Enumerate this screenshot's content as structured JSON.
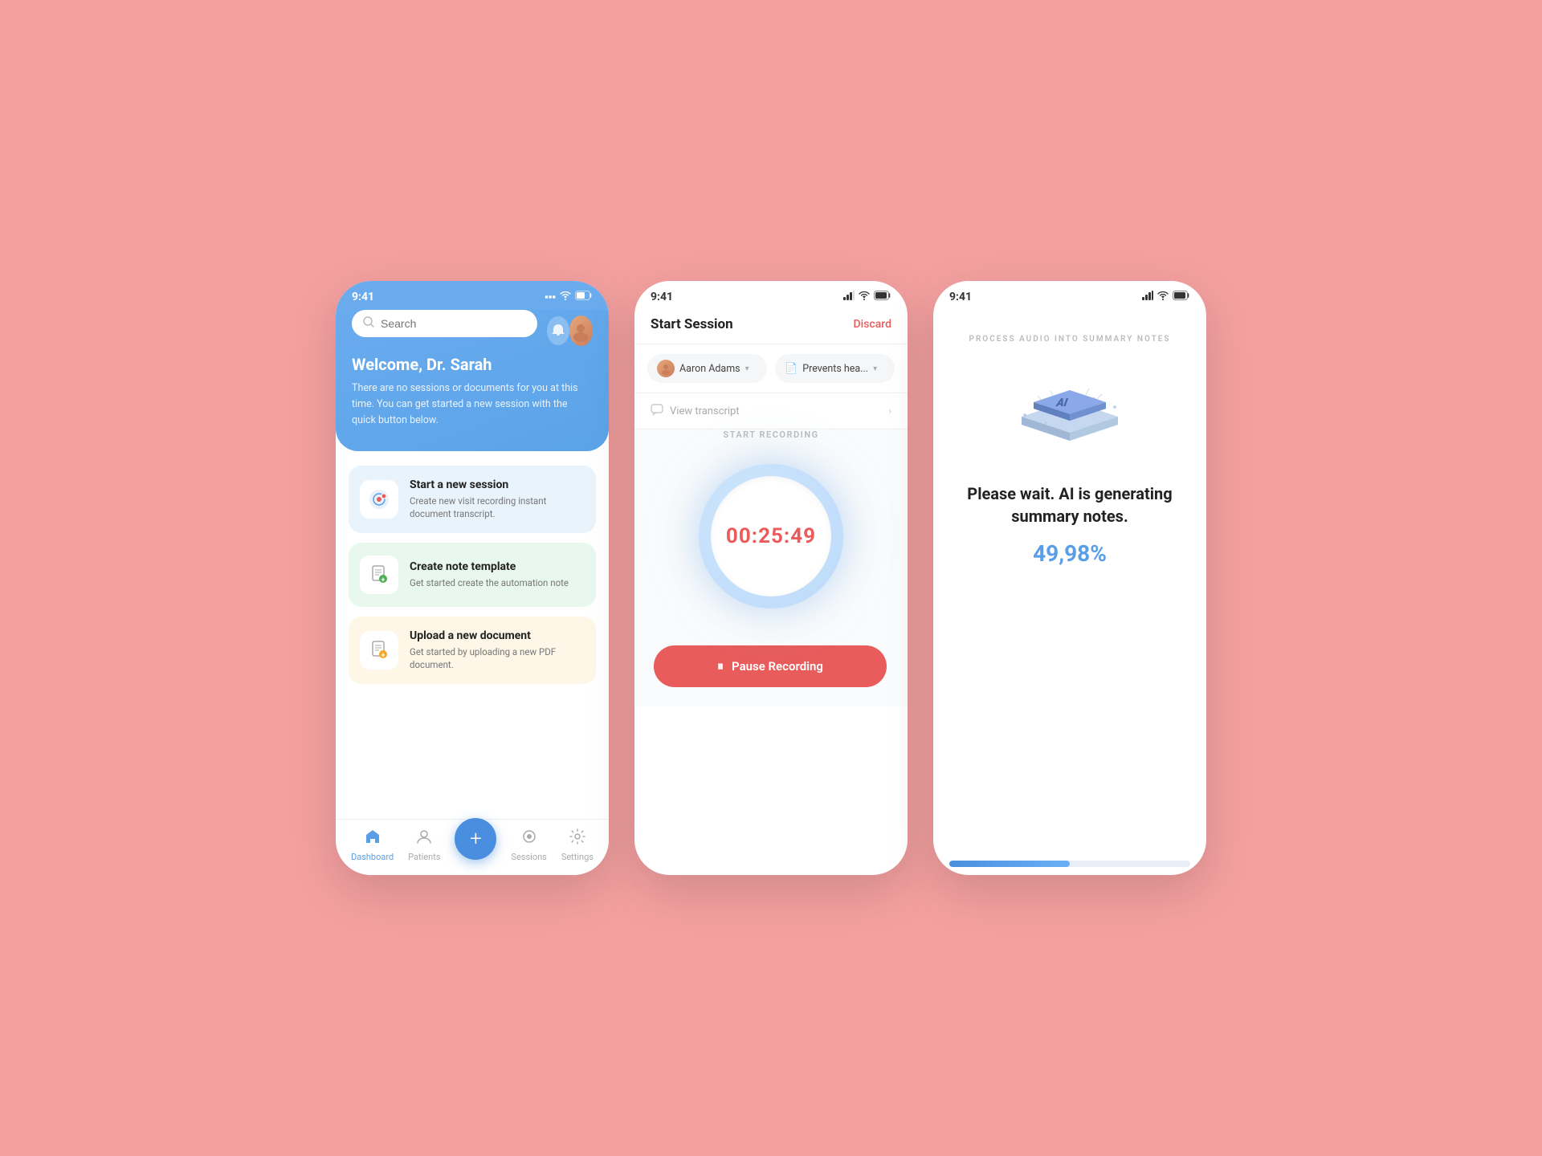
{
  "background": "#f4a0a0",
  "phone1": {
    "status": {
      "time": "9:41",
      "signal": "▪▪▪",
      "wifi": "WiFi",
      "battery": "🔋"
    },
    "search": {
      "placeholder": "Search"
    },
    "welcome": {
      "title": "Welcome, Dr. Sarah",
      "subtitle": "There are no sessions or documents for you at this time. You can get started a new session with the quick button below."
    },
    "cards": [
      {
        "title": "Start a new session",
        "subtitle": "Create new visit recording instant document transcript.",
        "color": "blue"
      },
      {
        "title": "Create note template",
        "subtitle": "Get started create the automation note",
        "color": "green"
      },
      {
        "title": "Upload a new document",
        "subtitle": "Get started by uploading a new PDF document.",
        "color": "yellow"
      }
    ],
    "nav": {
      "items": [
        {
          "label": "Dashboard",
          "active": true
        },
        {
          "label": "Patients",
          "active": false
        },
        {
          "label": "",
          "add": true
        },
        {
          "label": "Sessions",
          "active": false
        },
        {
          "label": "Settings",
          "active": false
        }
      ]
    }
  },
  "phone2": {
    "status": {
      "time": "9:41"
    },
    "header": {
      "title": "Start Session",
      "discard": "Discard"
    },
    "patient_dropdown": {
      "name": "Aaron Adams"
    },
    "document_dropdown": {
      "name": "Prevents hea..."
    },
    "transcript": {
      "label": "View transcript"
    },
    "recording": {
      "label": "START RECORDING",
      "timer": "00:25:49"
    },
    "pause_button": "Pause Recording"
  },
  "phone3": {
    "status": {
      "time": "9:41"
    },
    "process_label": "PROCESS AUDIO INTO SUMMARY NOTES",
    "waiting_text": "Please wait. AI is generating summary notes.",
    "percent": "49,98%",
    "progress": 50
  }
}
